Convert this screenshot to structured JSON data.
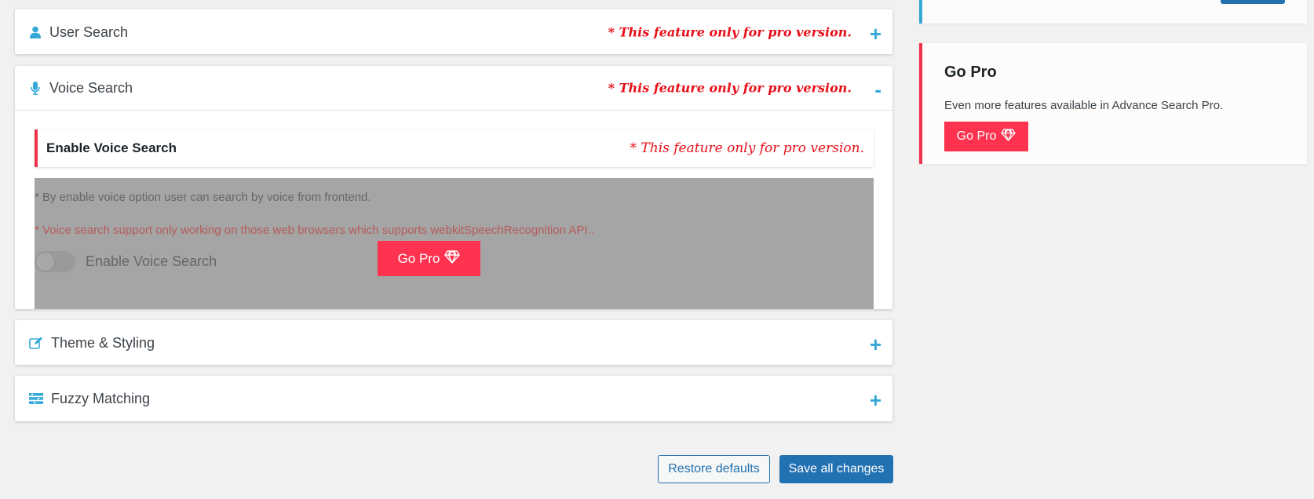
{
  "panels": {
    "user_search": {
      "title": "User Search",
      "pro_note": "* This feature only for pro version.",
      "toggle": "+",
      "icon": "user-icon"
    },
    "voice_search": {
      "title": "Voice Search",
      "pro_note": "* This feature only for pro version.",
      "toggle": "-",
      "icon": "microphone-icon",
      "subheading": "Enable Voice Search",
      "sub_note": "* This feature only for pro version.",
      "desc1": "* By enable voice option user can search by voice from frontend.",
      "desc2": "* Voice search support only working on those web browsers which supports webkitSpeechRecognition API..",
      "switch_label": "Enable Voice Search",
      "switch_on": false,
      "go_pro_label": "Go Pro"
    },
    "theme_styling": {
      "title": "Theme & Styling",
      "toggle": "+",
      "icon": "edit-icon"
    },
    "fuzzy_matching": {
      "title": "Fuzzy Matching",
      "toggle": "+",
      "icon": "list-settings-icon"
    }
  },
  "footer": {
    "restore_label": "Restore defaults",
    "save_label": "Save all changes"
  },
  "sidebar": {
    "go_pro": {
      "title": "Go Pro",
      "description": "Even more features available in Advance Search Pro.",
      "button_label": "Go Pro"
    }
  },
  "colors": {
    "accent": "#35a8d8",
    "pro_red": "#ff334f",
    "note_red": "#e8101a",
    "primary_blue": "#2271b1"
  }
}
